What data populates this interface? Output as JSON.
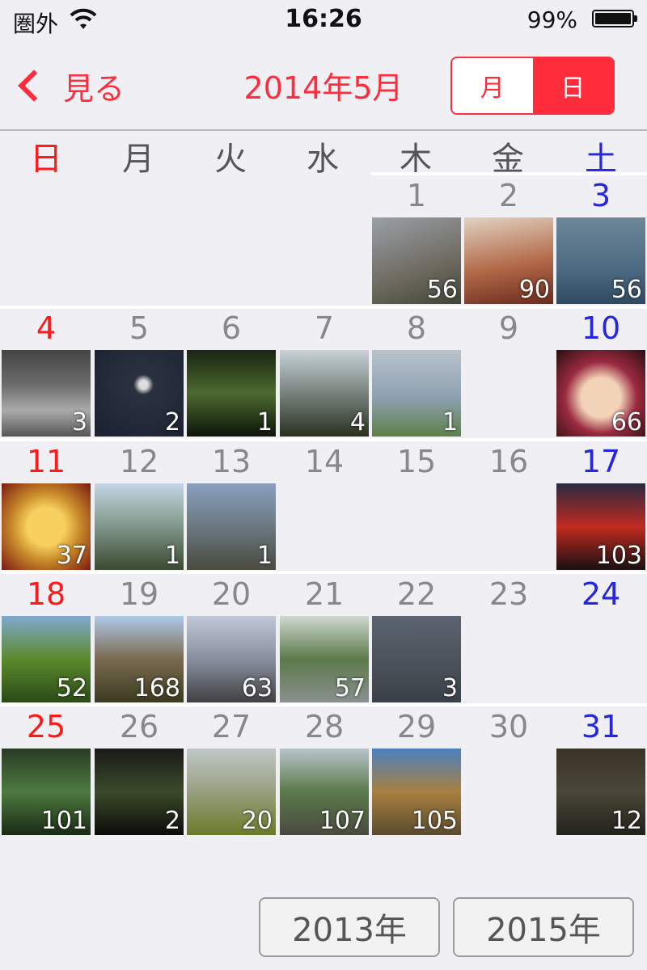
{
  "status_bar": {
    "carrier": "圏外",
    "time": "16:26",
    "battery_percent": "99%",
    "battery_level": 0.99
  },
  "nav": {
    "back_label": "見る",
    "title": "2014年5月",
    "segments": [
      {
        "label": "月",
        "selected": false
      },
      {
        "label": "日",
        "selected": true
      }
    ]
  },
  "weekdays": [
    "日",
    "月",
    "火",
    "水",
    "木",
    "金",
    "土"
  ],
  "days": [
    {
      "day": "1",
      "count": "56"
    },
    {
      "day": "2",
      "count": "90"
    },
    {
      "day": "3",
      "count": "56"
    },
    {
      "day": "4",
      "count": "3"
    },
    {
      "day": "5",
      "count": "2"
    },
    {
      "day": "6",
      "count": "1"
    },
    {
      "day": "7",
      "count": "4"
    },
    {
      "day": "8",
      "count": "1"
    },
    {
      "day": "9",
      "count": null
    },
    {
      "day": "10",
      "count": "66"
    },
    {
      "day": "11",
      "count": "37"
    },
    {
      "day": "12",
      "count": "1"
    },
    {
      "day": "13",
      "count": "1"
    },
    {
      "day": "14",
      "count": null
    },
    {
      "day": "15",
      "count": null
    },
    {
      "day": "16",
      "count": null
    },
    {
      "day": "17",
      "count": "103"
    },
    {
      "day": "18",
      "count": "52"
    },
    {
      "day": "19",
      "count": "168"
    },
    {
      "day": "20",
      "count": "63"
    },
    {
      "day": "21",
      "count": "57"
    },
    {
      "day": "22",
      "count": "3"
    },
    {
      "day": "23",
      "count": null
    },
    {
      "day": "24",
      "count": null
    },
    {
      "day": "25",
      "count": "101"
    },
    {
      "day": "26",
      "count": "2"
    },
    {
      "day": "27",
      "count": "20"
    },
    {
      "day": "28",
      "count": "107"
    },
    {
      "day": "29",
      "count": "105"
    },
    {
      "day": "30",
      "count": null
    },
    {
      "day": "31",
      "count": "12"
    }
  ],
  "footer": {
    "prev_year": "2013年",
    "next_year": "2015年"
  },
  "colors": {
    "accent": "#ff2d3b",
    "sunday": "#ff1a1a",
    "saturday": "#2626e0",
    "weekday": "#888888"
  }
}
